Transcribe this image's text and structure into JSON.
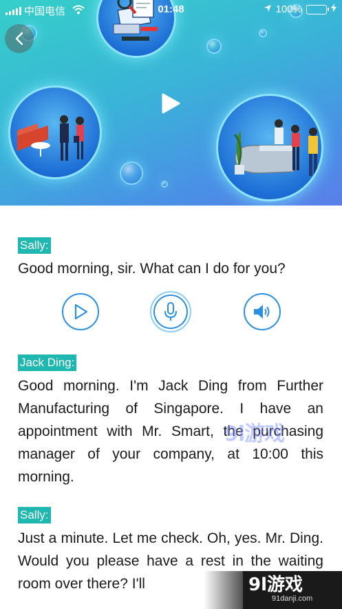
{
  "status_bar": {
    "carrier": "中国电信",
    "time": "01:48",
    "battery_percent": "100%",
    "icons": [
      "signal-icon",
      "wifi-icon",
      "location-icon",
      "battery-icon",
      "charging-icon"
    ]
  },
  "hero": {
    "back_icon": "chevron-left-icon",
    "play_icon": "play-icon"
  },
  "dialogue": [
    {
      "speaker": "Sally:",
      "text": "Good morning, sir. What can I do for you?"
    },
    {
      "speaker": "Jack Ding:",
      "text": "Good morning. I'm Jack Ding from Further Manufacturing of Singapore. I have an appointment with Mr. Smart, the purchasing manager of your company, at 10:00 this morning."
    },
    {
      "speaker": "Sally:",
      "text": "Just a minute. Let me check. Oh, yes. Mr. Ding. Would you please have a rest in the waiting room over there? I'll"
    }
  ],
  "controls": {
    "play_icon": "play-circle-icon",
    "record_icon": "microphone-icon",
    "listen_icon": "speaker-icon"
  },
  "watermark": {
    "text": "9l游戏",
    "logo_big": "9l游戏",
    "logo_small": "91danji.com"
  },
  "colors": {
    "speaker_tag": "#1fb8b1",
    "control_blue": "#2a8fe0",
    "hero_start": "#35cfc9",
    "hero_end": "#5a7fe8"
  }
}
